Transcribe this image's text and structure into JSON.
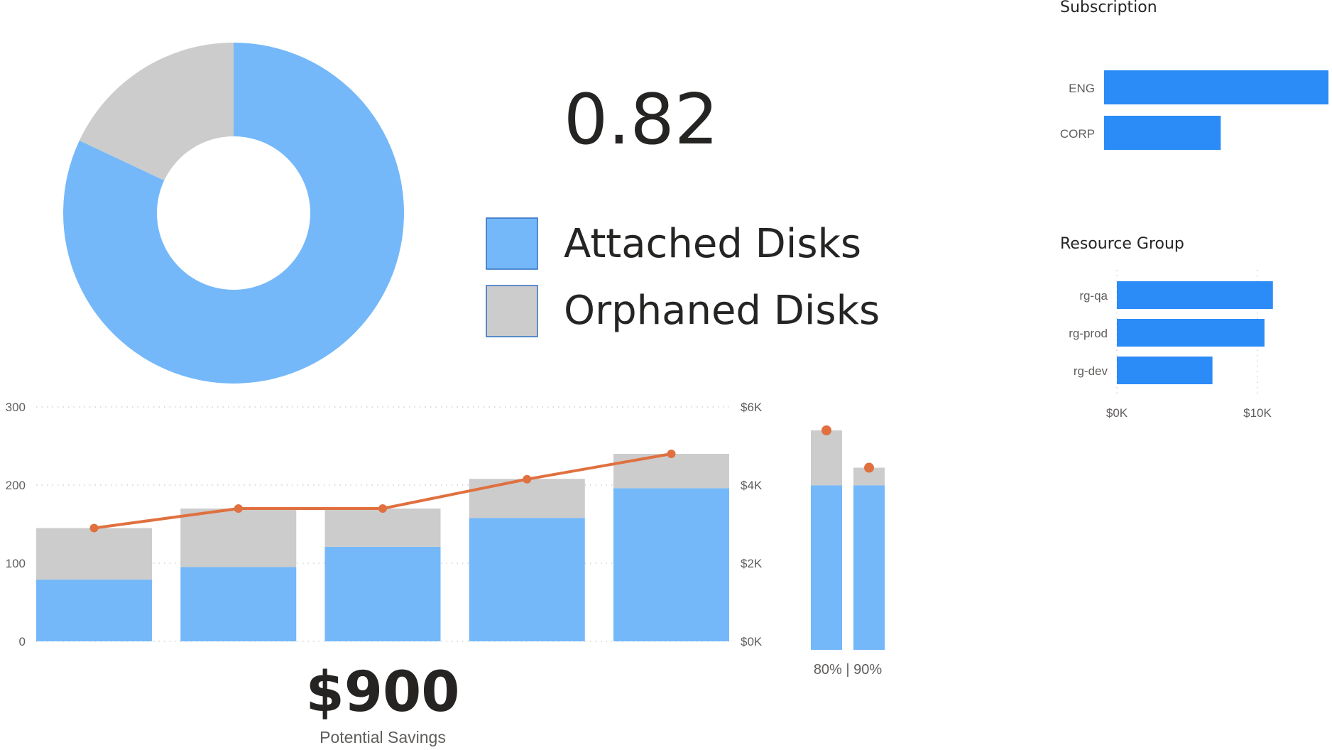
{
  "colors": {
    "attached": "#74B8FA",
    "orphaned": "#CCCCCC",
    "line": "#E0703F",
    "bar_blue": "#2B8BF7",
    "legend_border": "#2F6FC0"
  },
  "kpi": {
    "ratio": "0.82",
    "savings": "$900",
    "savings_label": "Potential Savings",
    "percent_label": "80% | 90%"
  },
  "chart_data": [
    {
      "type": "pie",
      "variant": "donut",
      "categories": [
        "Attached Disks",
        "Orphaned Disks"
      ],
      "values": [
        82,
        18
      ],
      "legend": {
        "placement": "right",
        "items": [
          "Attached Disks",
          "Orphaned Disks"
        ]
      }
    },
    {
      "type": "bar",
      "stacked": true,
      "categories": [
        "",
        "",
        "",
        "",
        ""
      ],
      "series": [
        {
          "values": [
            79,
            95,
            121,
            158,
            196
          ]
        },
        {
          "values": [
            66,
            75,
            49,
            50,
            44
          ]
        }
      ],
      "line": {
        "axis": "right",
        "values": [
          2900,
          3400,
          3400,
          4150,
          4800
        ]
      },
      "ylim": [
        0,
        300
      ],
      "y_ticks": [
        "0",
        "100",
        "200",
        "300"
      ],
      "y2lim": [
        0,
        6000
      ],
      "y2_ticks": [
        "$0K",
        "$2K",
        "$4K",
        "$6K"
      ],
      "grid": true
    },
    {
      "type": "bar",
      "stacked": true,
      "categories": [
        "80%",
        "90%"
      ],
      "series": [
        {
          "values": [
            0.75,
            0.75
          ]
        },
        {
          "values": [
            0.25,
            0.08
          ]
        }
      ],
      "markers": [
        1.0,
        0.83
      ]
    },
    {
      "type": "bar",
      "orientation": "horizontal",
      "title": "Subscription",
      "categories": [
        "ENG",
        "CORP"
      ],
      "values": [
        1.0,
        0.52
      ]
    },
    {
      "type": "bar",
      "orientation": "horizontal",
      "title": "Resource Group",
      "categories": [
        "rg-qa",
        "rg-prod",
        "rg-dev"
      ],
      "values": [
        11100,
        10500,
        6800
      ],
      "x_ticks": [
        "$0K",
        "$10K"
      ],
      "xlim": [
        0,
        10000
      ],
      "grid": true
    }
  ]
}
